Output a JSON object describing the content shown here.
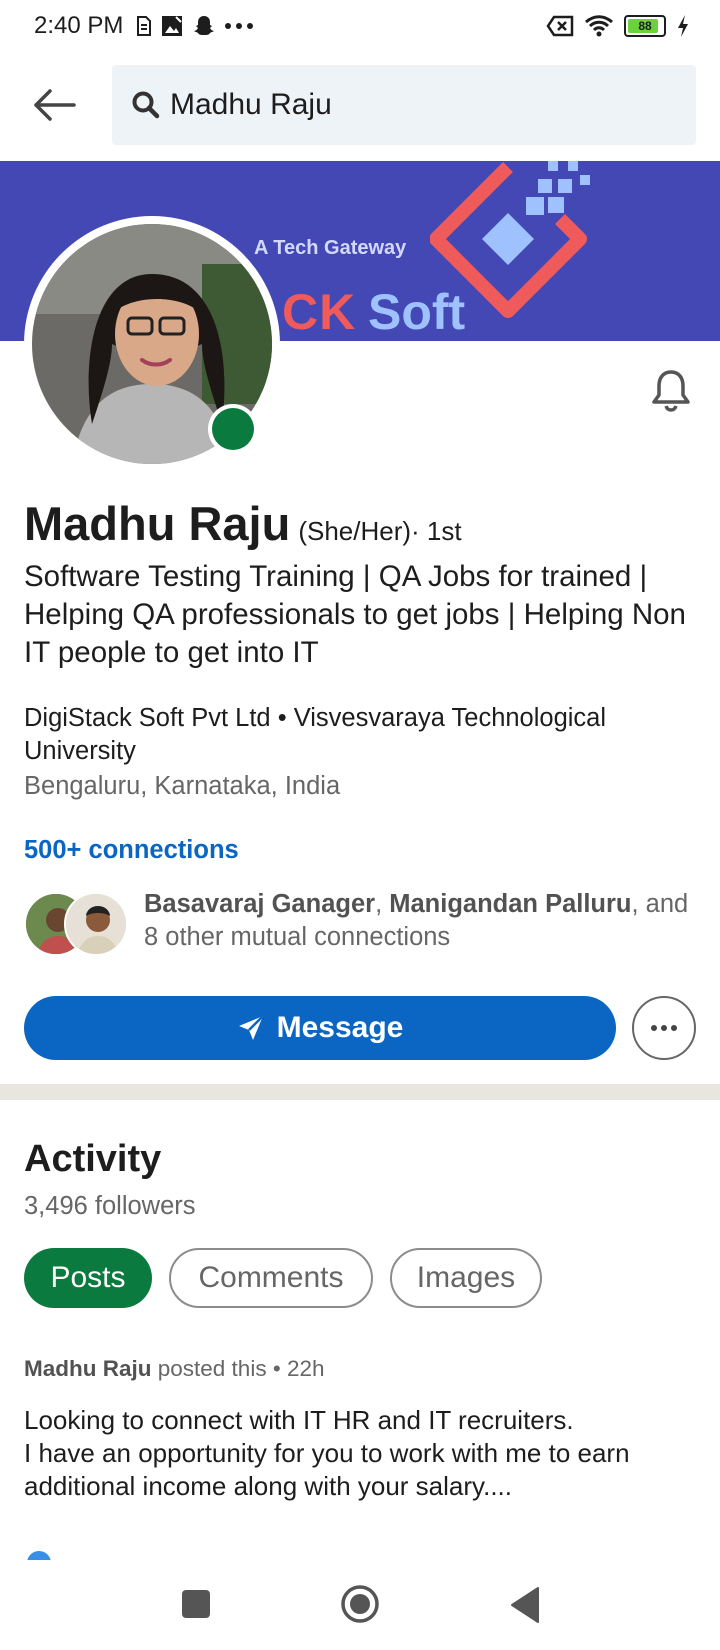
{
  "status_bar": {
    "time": "2:40 PM",
    "battery": "88",
    "battery_fraction": 0.88,
    "icons_left": [
      "sim-icon",
      "gallery-icon",
      "snapchat-icon",
      "more-dots-icon"
    ],
    "icons_right": [
      "no-sim-icon",
      "wifi-icon",
      "battery-icon",
      "charging-icon"
    ]
  },
  "search": {
    "query": "Madhu Raju"
  },
  "banner": {
    "tagline": "A Tech Gateway",
    "brand_part1": "CK",
    "brand_part2": "Soft"
  },
  "profile": {
    "name": "Madhu Raju",
    "pronouns": "(She/Her)",
    "degree": " · 1st",
    "headline": "Software Testing Training | QA Jobs for trained | Helping QA professionals to get jobs | Helping Non IT people to get into IT",
    "education": "DigiStack Soft Pvt Ltd • Visvesvaraya Technological University",
    "location": "Bengaluru, Karnataka, India",
    "connections": "500+ connections",
    "mutual": {
      "name1": "Basavaraj Ganager",
      "separator": ", ",
      "name2": "Manigandan Palluru",
      "suffix": ", and 8 other mutual connections"
    }
  },
  "actions": {
    "message_label": "Message"
  },
  "activity": {
    "title": "Activity",
    "followers": "3,496 followers",
    "tabs": [
      "Posts",
      "Comments",
      "Images"
    ],
    "post": {
      "author": "Madhu Raju",
      "meta": " posted this • 22h",
      "text_line1": "Looking to connect with IT HR and IT recruiters.",
      "text_line2": "I have an opportunity for you to work with me to earn additional income along with your salary...."
    }
  },
  "colors": {
    "accent_blue": "#0a66c2",
    "active_green": "#0b7a3e",
    "banner": "#4348b4"
  }
}
